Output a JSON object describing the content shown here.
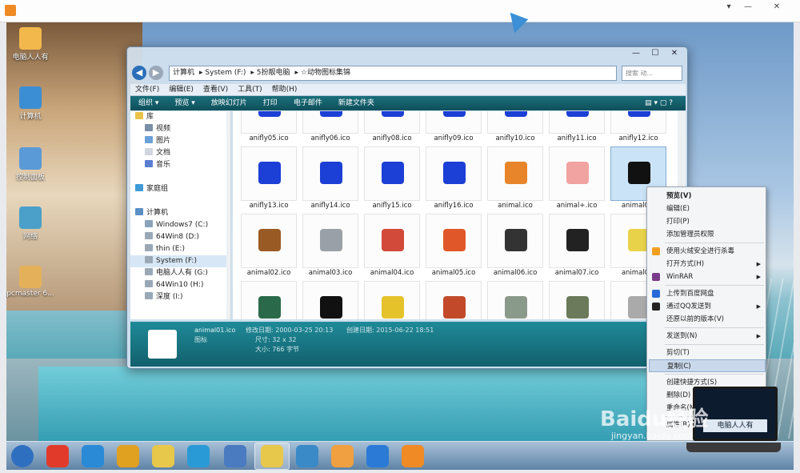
{
  "desktop": {
    "icons": [
      {
        "label": "电脑人人有",
        "color": "#f2b84b"
      },
      {
        "label": "计算机",
        "color": "#3c8ed4"
      },
      {
        "label": "控制面板",
        "color": "#5a9ad6"
      },
      {
        "label": "网络",
        "color": "#4aa0c8"
      },
      {
        "label": "pcmaster 6...",
        "color": "#e4b15a"
      }
    ]
  },
  "explorer": {
    "window_controls": [
      "—",
      "☐",
      "✕"
    ],
    "breadcrumb": [
      "计算机",
      "System (F:)",
      "5扮靓电脑",
      "☆动物图标集锦"
    ],
    "search_placeholder": "搜索 动...",
    "menu": [
      "文件(F)",
      "编辑(E)",
      "查看(V)",
      "工具(T)",
      "帮助(H)"
    ],
    "toolbar": [
      "组织 ▾",
      "预览 ▾",
      "放映幻灯片",
      "打印",
      "电子邮件",
      "新建文件夹"
    ],
    "nav": [
      {
        "label": "库",
        "indent": 0,
        "color": "#e9c34a"
      },
      {
        "label": "视频",
        "indent": 1,
        "color": "#7a8fa8"
      },
      {
        "label": "图片",
        "indent": 1,
        "color": "#6ca0d8"
      },
      {
        "label": "文档",
        "indent": 1,
        "color": "#cfd6e0"
      },
      {
        "label": "音乐",
        "indent": 1,
        "color": "#5b7fd0"
      },
      {
        "label": "",
        "indent": 0,
        "color": "transparent"
      },
      {
        "label": "家庭组",
        "indent": 0,
        "color": "#3f9ad6"
      },
      {
        "label": "",
        "indent": 0,
        "color": "transparent"
      },
      {
        "label": "计算机",
        "indent": 0,
        "color": "#5c8fc4"
      },
      {
        "label": "Windows7 (C:)",
        "indent": 1,
        "color": "#8aa3bb"
      },
      {
        "label": "64Win8 (D:)",
        "indent": 1,
        "color": "#9aa8b6"
      },
      {
        "label": "thin (E:)",
        "indent": 1,
        "color": "#9aa8b6"
      },
      {
        "label": "System (F:)",
        "indent": 1,
        "color": "#9aa8b6",
        "selected": true
      },
      {
        "label": "电脑人人有 (G:)",
        "indent": 1,
        "color": "#9aa8b6"
      },
      {
        "label": "64Win10 (H:)",
        "indent": 1,
        "color": "#9aa8b6"
      },
      {
        "label": "深度 (I:)",
        "indent": 1,
        "color": "#9aa8b6"
      }
    ],
    "files": [
      {
        "name": "anifly05.ico",
        "color": "#1c3fd6"
      },
      {
        "name": "anifly06.ico",
        "color": "#1c3fd6"
      },
      {
        "name": "anifly08.ico",
        "color": "#1c3fd6"
      },
      {
        "name": "anifly09.ico",
        "color": "#1c3fd6"
      },
      {
        "name": "anifly10.ico",
        "color": "#1c3fd6"
      },
      {
        "name": "anifly11.ico",
        "color": "#1c3fd6"
      },
      {
        "name": "anifly12.ico",
        "color": "#1c3fd6"
      },
      {
        "name": "anifly13.ico",
        "color": "#1c3fd6"
      },
      {
        "name": "anifly14.ico",
        "color": "#1c3fd6"
      },
      {
        "name": "anifly15.ico",
        "color": "#1c3fd6"
      },
      {
        "name": "anifly16.ico",
        "color": "#1c3fd6"
      },
      {
        "name": "animal.ico",
        "color": "#e8842a"
      },
      {
        "name": "animal+.ico",
        "color": "#f0a3a0"
      },
      {
        "name": "animal0...",
        "color": "#111111",
        "selected": true
      },
      {
        "name": "animal02.ico",
        "color": "#9a5a24"
      },
      {
        "name": "animal03.ico",
        "color": "#9aa0a8"
      },
      {
        "name": "animal04.ico",
        "color": "#d24a3a"
      },
      {
        "name": "animal05.ico",
        "color": "#e0582a"
      },
      {
        "name": "animal06.ico",
        "color": "#333333"
      },
      {
        "name": "animal07.ico",
        "color": "#222222"
      },
      {
        "name": "animal0...",
        "color": "#e8d24a"
      },
      {
        "name": "",
        "color": "#2a6a4a"
      },
      {
        "name": "",
        "color": "#111111"
      },
      {
        "name": "",
        "color": "#e6c22a"
      },
      {
        "name": "",
        "color": "#c24a2a"
      },
      {
        "name": "",
        "color": "#8a9a8a"
      },
      {
        "name": "",
        "color": "#6a7a5a"
      },
      {
        "name": "",
        "color": "#aaaaaa"
      }
    ],
    "details": {
      "filename": "animal01.ico",
      "modified_label": "修改日期: 2000-03-25 20:13",
      "created_label": "创建日期: 2015-06-22 18:51",
      "type": "图标",
      "size_label": "尺寸: 32 x 32",
      "filesize_label": "大小: 766 字节"
    }
  },
  "context_menu": {
    "items": [
      {
        "label": "预览(V)",
        "bold": true
      },
      {
        "label": "编辑(E)"
      },
      {
        "label": "打印(P)"
      },
      {
        "label": "添加管理员权限"
      },
      {
        "sep": true
      },
      {
        "label": "使用火绒安全进行杀毒",
        "icon": "#f0a020"
      },
      {
        "label": "打开方式(H)",
        "submenu": true
      },
      {
        "label": "WinRAR",
        "submenu": true,
        "icon": "#7a3a8a"
      },
      {
        "sep": true
      },
      {
        "label": "上传到百度网盘",
        "icon": "#2a6ad6"
      },
      {
        "label": "通过QQ发送到",
        "submenu": true,
        "icon": "#222222"
      },
      {
        "label": "还原以前的版本(V)"
      },
      {
        "sep": true
      },
      {
        "label": "发送到(N)",
        "submenu": true
      },
      {
        "sep": true
      },
      {
        "label": "剪切(T)"
      },
      {
        "label": "复制(C)",
        "hover": true
      },
      {
        "sep": true
      },
      {
        "label": "创建快捷方式(S)"
      },
      {
        "label": "删除(D)"
      },
      {
        "label": "重命名(M)"
      },
      {
        "sep": true
      },
      {
        "label": "属性(R)"
      }
    ]
  },
  "taskbar": {
    "items": [
      {
        "name": "start-orb",
        "color": "#2f6fc0"
      },
      {
        "name": "app-jiang",
        "color": "#e23a2a"
      },
      {
        "name": "internet-explorer",
        "color": "#2a8ad6"
      },
      {
        "name": "chrome",
        "color": "#e0a020"
      },
      {
        "name": "folder-note",
        "color": "#e8c84a"
      },
      {
        "name": "browser-c",
        "color": "#2a9ad6"
      },
      {
        "name": "remote-desktop",
        "color": "#4a7ac0"
      },
      {
        "name": "file-explorer",
        "color": "#e8c84a"
      },
      {
        "name": "pinwheel",
        "color": "#3a8ac8"
      },
      {
        "name": "paint",
        "color": "#f0a040"
      },
      {
        "name": "settings-dots",
        "color": "#2a7ad6"
      },
      {
        "name": "media-player",
        "color": "#f08a24"
      }
    ]
  },
  "laptop_text": "电脑人人有",
  "watermark": {
    "brand": "Baidu经验",
    "url": "jingyan.baidu.com"
  }
}
